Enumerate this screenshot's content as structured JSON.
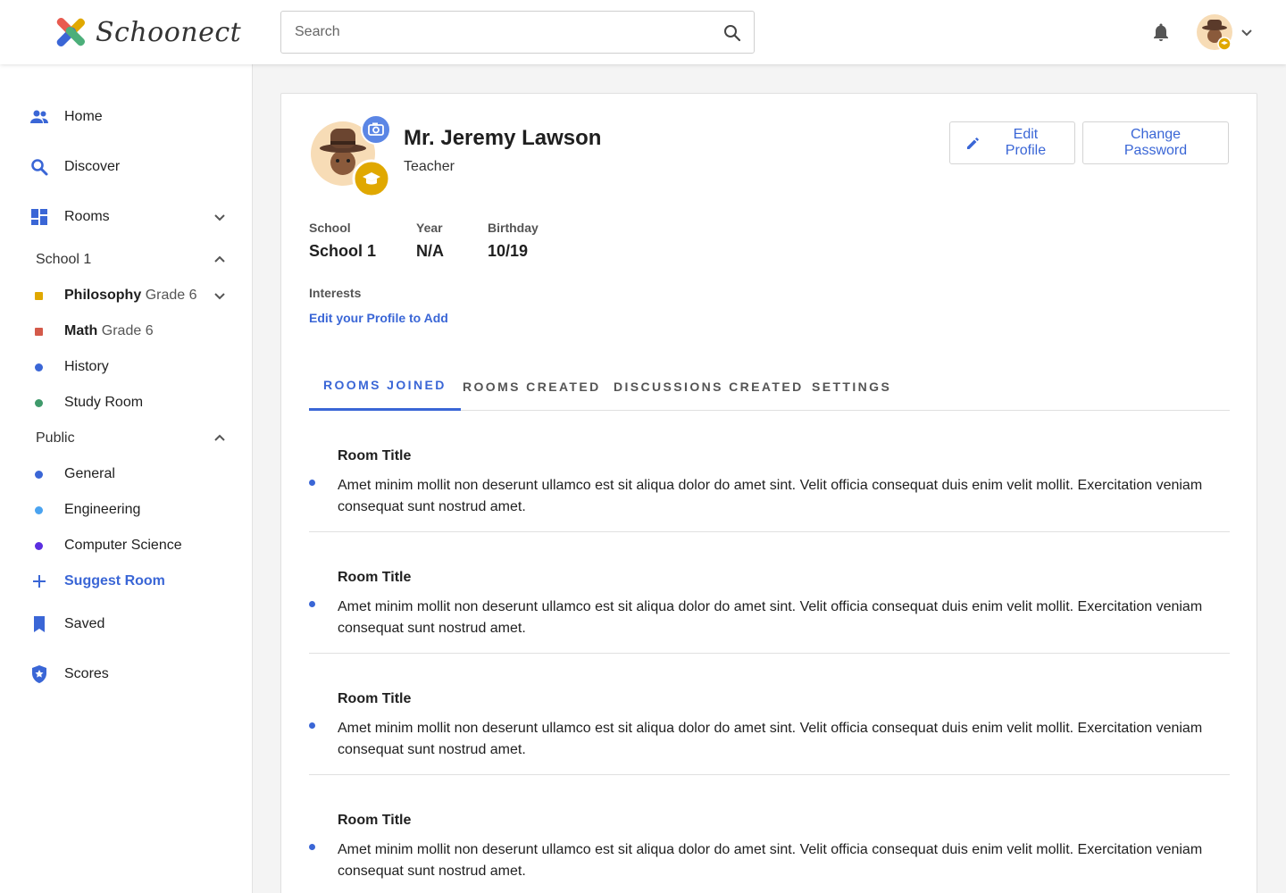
{
  "app": {
    "name": "Schoonect",
    "accent": "#3a66d6"
  },
  "header": {
    "search_placeholder": "Search",
    "icons": [
      "search-icon",
      "bell-icon",
      "chevron-down-icon"
    ]
  },
  "sidebar": {
    "home": "Home",
    "discover": "Discover",
    "rooms": "Rooms",
    "school_group": "School 1",
    "school_rooms": [
      {
        "name": "Philosophy",
        "grade": "Grade 6",
        "color": "#e0a800"
      },
      {
        "name": "Math",
        "grade": "Grade 6",
        "color": "#d45a4a"
      },
      {
        "name": "History",
        "color": "#3a66d6"
      },
      {
        "name": "Study Room",
        "color": "#3f9a6b"
      }
    ],
    "public_group": "Public",
    "public_rooms": [
      {
        "name": "General",
        "color": "#3a66d6"
      },
      {
        "name": "Engineering",
        "color": "#4aa3f0"
      },
      {
        "name": "Computer Science",
        "color": "#5b2ee0"
      }
    ],
    "suggest": "Suggest Room",
    "saved": "Saved",
    "scores": "Scores"
  },
  "profile": {
    "name": "Mr. Jeremy Lawson",
    "role": "Teacher",
    "edit_button": "Edit Profile",
    "password_button": "Change Password",
    "fields": {
      "school_label": "School",
      "school_value": "School 1",
      "year_label": "Year",
      "year_value": "N/A",
      "birthday_label": "Birthday",
      "birthday_value": "10/19"
    },
    "interests_label": "Interests",
    "interests_link": "Edit your Profile to Add"
  },
  "tabs": [
    "ROOMS JOINED",
    "ROOMS CREATED",
    "DISCUSSIONS CREATED",
    "SETTINGS"
  ],
  "rooms_joined": [
    {
      "title": "Room Title",
      "body": "Amet minim mollit non deserunt ullamco est sit aliqua dolor do amet sint. Velit officia consequat duis enim velit mollit. Exercitation veniam consequat sunt nostrud amet."
    },
    {
      "title": "Room Title",
      "body": "Amet minim mollit non deserunt ullamco est sit aliqua dolor do amet sint. Velit officia consequat duis enim velit mollit. Exercitation veniam consequat sunt nostrud amet."
    },
    {
      "title": "Room Title",
      "body": "Amet minim mollit non deserunt ullamco est sit aliqua dolor do amet sint. Velit officia consequat duis enim velit mollit. Exercitation veniam consequat sunt nostrud amet."
    },
    {
      "title": "Room Title",
      "body": "Amet minim mollit non deserunt ullamco est sit aliqua dolor do amet sint. Velit officia consequat duis enim velit mollit. Exercitation veniam consequat sunt nostrud amet."
    }
  ]
}
